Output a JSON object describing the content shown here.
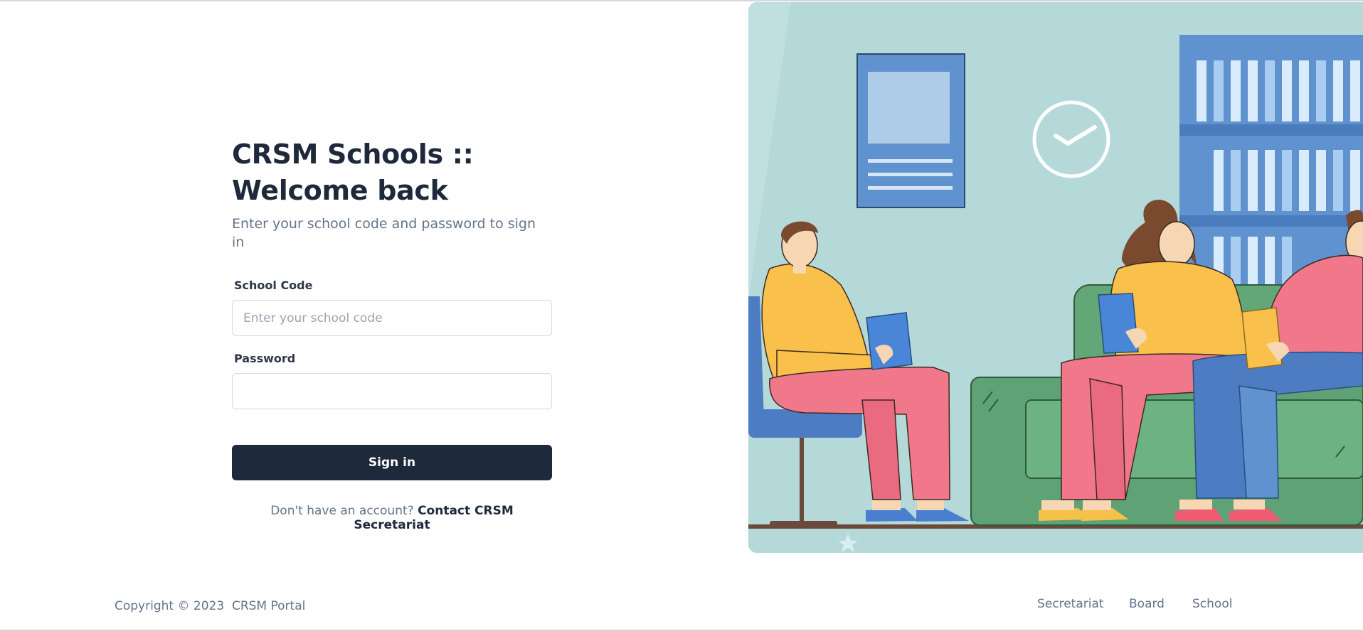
{
  "login": {
    "title": "CRSM Schools :: Welcome back",
    "subtitle": "Enter your school code and password to sign in",
    "school_code_label": "School Code",
    "school_code_placeholder": "Enter your school code",
    "school_code_value": "",
    "password_label": "Password",
    "password_value": "",
    "submit_label": "Sign in",
    "signup_prompt": "Don't have an account?",
    "signup_link": "Contact CRSM Secretariat"
  },
  "footer": {
    "copyright": "Copyright © 2023  CRSM Portal",
    "links": [
      "Secretariat",
      "Board",
      "School"
    ]
  },
  "theme": {
    "primary": "#1e293b",
    "muted_text": "#64748b",
    "illustration_bg": "#b5d8d9"
  },
  "illustration": {
    "description_icon": "people-reading-illustration"
  }
}
